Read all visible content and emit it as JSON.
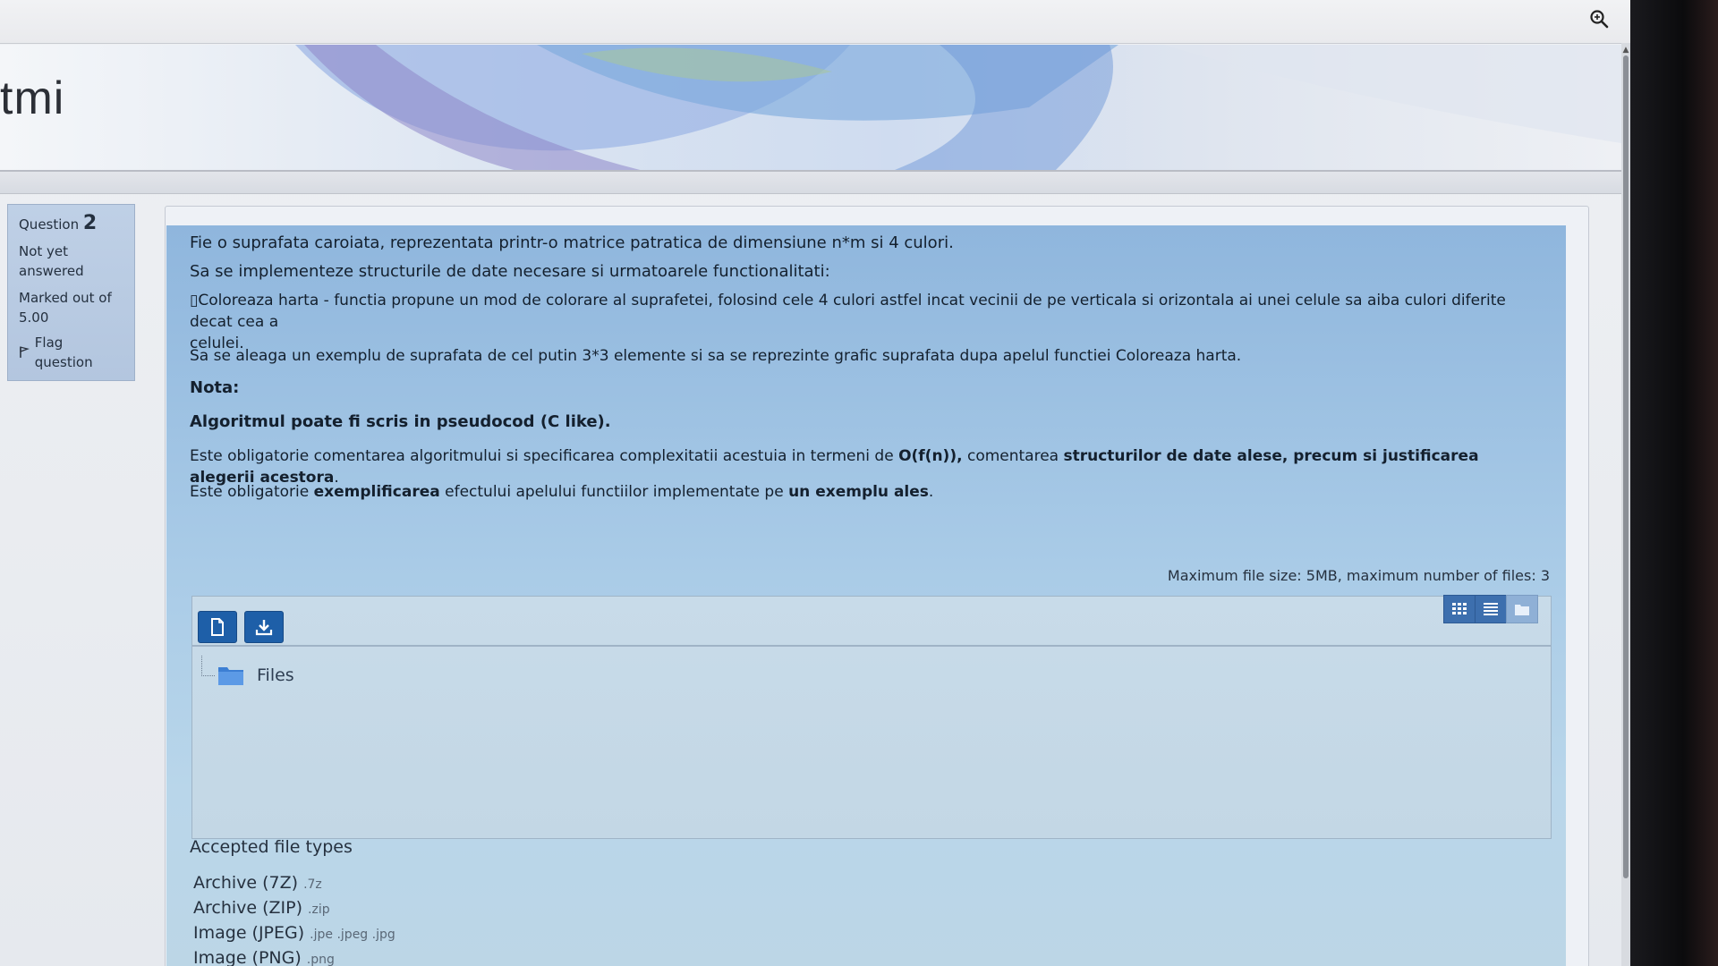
{
  "header": {
    "site_title": "tmi"
  },
  "question_info": {
    "label": "Question",
    "number": "2",
    "state_line1": "Not yet",
    "state_line2": "answered",
    "marks_line1": "Marked out of",
    "marks_line2": "5.00",
    "flag_label": "Flag question"
  },
  "question": {
    "p1": "Fie o suprafata caroiata, reprezentata printr-o matrice patratica de dimensiune n*m si 4 culori.",
    "p2": "Sa se implementeze structurile de date necesare si urmatoarele functionalitati:",
    "p3": "▯Coloreaza harta - functia propune un mod de colorare al suprafetei, folosind cele 4 culori astfel incat vecinii de pe verticala si orizontala ai unei celule sa aiba culori diferite decat cea a",
    "p3b": "celulei.",
    "p4": "Sa se aleaga un exemplu de suprafata de cel putin 3*3 elemente si sa se reprezinte grafic suprafata dupa apelul functiei Coloreaza harta.",
    "nota": "Nota:",
    "alg": "Algoritmul poate fi scris in pseudocod (C like).",
    "p5a": "Este obligatorie comentarea algoritmului si specificarea complexitatii acestuia in termeni de ",
    "p5b": "O(f(n)),",
    "p5c": " comentarea ",
    "p5d": "structurilor de date alese, precum si justificarea alegerii acestora",
    "p5e": ".",
    "p6a": "Este obligatorie ",
    "p6b": "exemplificarea",
    "p6c": " efectului apelului functiilor implementate pe ",
    "p6d": "un exemplu ales",
    "p6e": "."
  },
  "file_manager": {
    "limits": "Maximum file size: 5MB, maximum number of files: 3",
    "folder_label": "Files"
  },
  "accepted": {
    "title": "Accepted file types",
    "types": [
      {
        "name": "Archive (7Z)",
        "ext": ".7z"
      },
      {
        "name": "Archive (ZIP)",
        "ext": ".zip"
      },
      {
        "name": "Image (JPEG)",
        "ext": ".jpe .jpeg .jpg"
      },
      {
        "name": "Image (PNG)",
        "ext": ".png"
      }
    ]
  },
  "colors": {
    "primary_button": "#1e5fa8",
    "question_bg": "#a9cbe7",
    "info_bg": "#bfd0e6"
  },
  "icons": [
    "zoom-icon",
    "flag-icon",
    "add-file-icon",
    "download-icon",
    "grid-view-icon",
    "list-view-icon",
    "tree-view-icon",
    "folder-icon"
  ]
}
